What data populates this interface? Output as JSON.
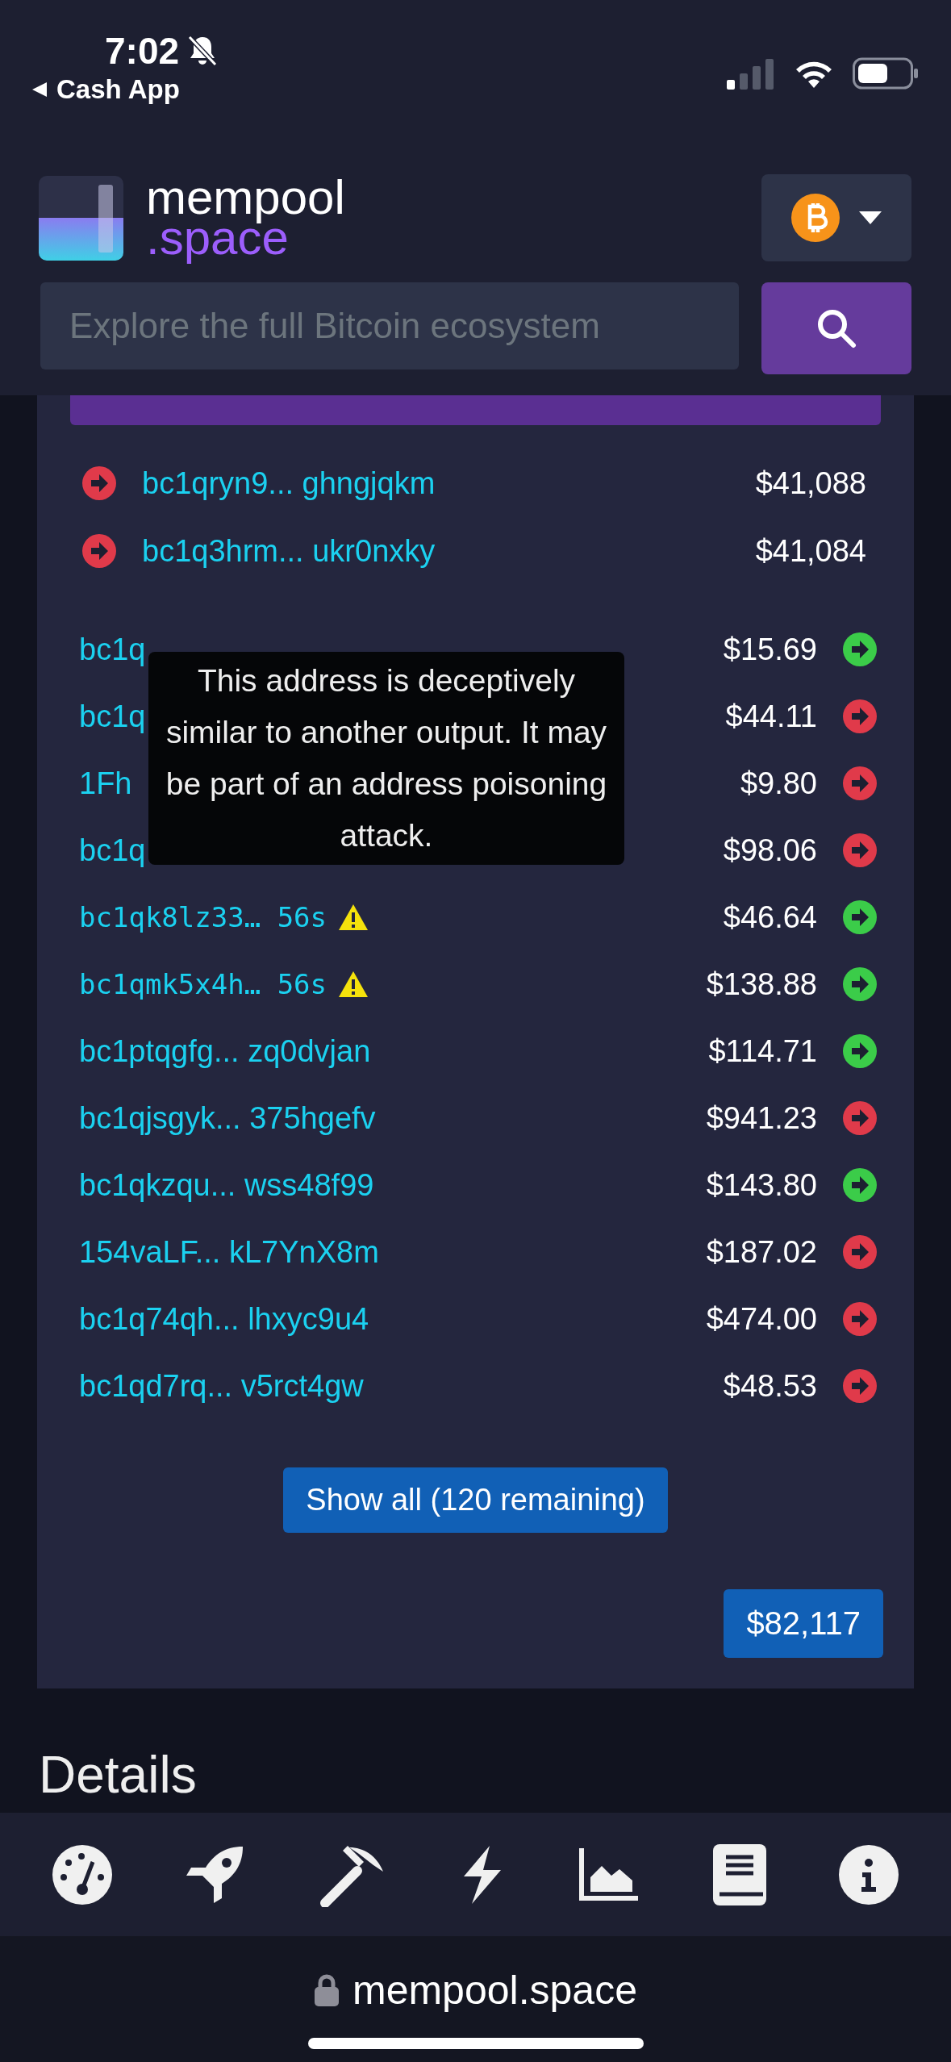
{
  "status_bar": {
    "time": "7:02",
    "back_app": "Cash App"
  },
  "header": {
    "logo_top": "mempool",
    "logo_bottom": ".space",
    "search": {
      "placeholder": "Explore the full Bitcoin ecosystem"
    }
  },
  "inputs": [
    {
      "address": "bc1qryn9... ghngjqkm",
      "amount": "$41,088",
      "color": "#e03a4a"
    },
    {
      "address": "bc1q3hrm... ukr0nxky",
      "amount": "$41,084",
      "color": "#e03a4a"
    }
  ],
  "outputs": [
    {
      "kind": "plain",
      "address": "bc1q",
      "amount": "$15.69",
      "color": "#3bcc49"
    },
    {
      "kind": "plain",
      "address": "bc1q",
      "amount": "$44.11",
      "color": "#e03a4a"
    },
    {
      "kind": "plain",
      "address": "1Fh",
      "amount": "$9.80",
      "color": "#e03a4a"
    },
    {
      "kind": "plain",
      "address": "bc1q",
      "amount": "$98.06",
      "color": "#e03a4a"
    },
    {
      "kind": "flagged",
      "address": "bc1qk8lz33… 56s",
      "amount": "$46.64",
      "color": "#3bcc49"
    },
    {
      "kind": "flagged",
      "address": "bc1qmk5x4h… 56s",
      "amount": "$138.88",
      "color": "#3bcc49"
    },
    {
      "kind": "plain",
      "address": "bc1ptqgfg... zq0dvjan",
      "amount": "$114.71",
      "color": "#3bcc49"
    },
    {
      "kind": "plain",
      "address": "bc1qjsgyk... 375hgefv",
      "amount": "$941.23",
      "color": "#e03a4a"
    },
    {
      "kind": "plain",
      "address": "bc1qkzqu... wss48f99",
      "amount": "$143.80",
      "color": "#3bcc49"
    },
    {
      "kind": "plain",
      "address": "154vaLF... kL7YnX8m",
      "amount": "$187.02",
      "color": "#e03a4a"
    },
    {
      "kind": "plain",
      "address": "bc1q74qh... lhxyc9u4",
      "amount": "$474.00",
      "color": "#e03a4a"
    },
    {
      "kind": "plain",
      "address": "bc1qd7rq... v5rct4gw",
      "amount": "$48.53",
      "color": "#e03a4a"
    }
  ],
  "tooltip": "This address is deceptively similar to another output. It may be part of an address poisoning attack.",
  "show_all_button": "Show all (120 remaining)",
  "total": "$82,117",
  "details_heading": "Details",
  "browser": {
    "url": "mempool.space"
  }
}
